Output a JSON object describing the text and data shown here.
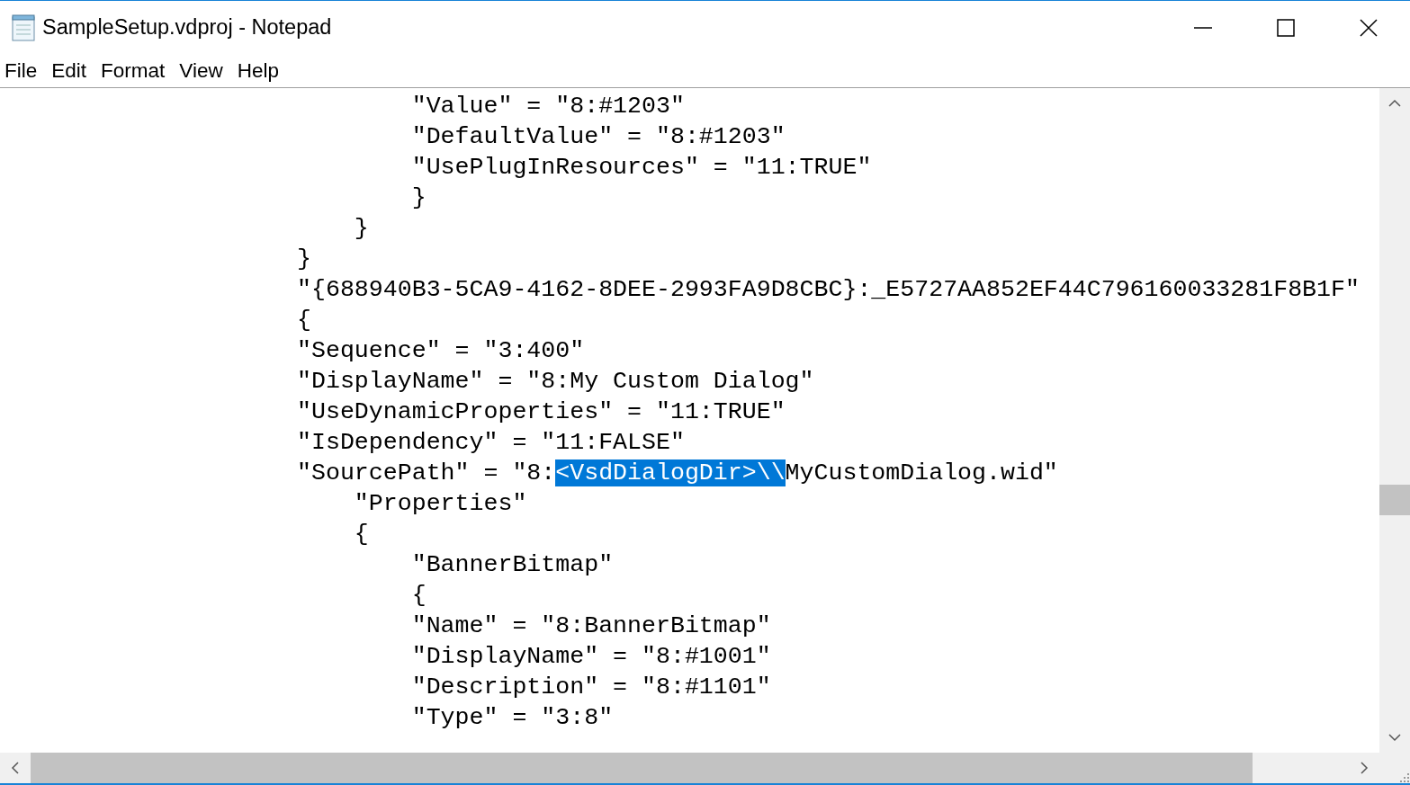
{
  "window": {
    "title": "SampleSetup.vdproj - Notepad"
  },
  "menu": [
    "File",
    "Edit",
    "Format",
    "View",
    "Help"
  ],
  "editor": {
    "lines": [
      [
        {
          "text": "        \"Value\" = \"8:#1203\"",
          "selected": false
        }
      ],
      [
        {
          "text": "        \"DefaultValue\" = \"8:#1203\"",
          "selected": false
        }
      ],
      [
        {
          "text": "        \"UsePlugInResources\" = \"11:TRUE\"",
          "selected": false
        }
      ],
      [
        {
          "text": "        }",
          "selected": false
        }
      ],
      [
        {
          "text": "    }",
          "selected": false
        }
      ],
      [
        {
          "text": "}",
          "selected": false
        }
      ],
      [
        {
          "text": "\"{688940B3-5CA9-4162-8DEE-2993FA9D8CBC}:_E5727AA852EF44C796160033281F8B1F\"",
          "selected": false
        }
      ],
      [
        {
          "text": "{",
          "selected": false
        }
      ],
      [
        {
          "text": "\"Sequence\" = \"3:400\"",
          "selected": false
        }
      ],
      [
        {
          "text": "\"DisplayName\" = \"8:My Custom Dialog\"",
          "selected": false
        }
      ],
      [
        {
          "text": "\"UseDynamicProperties\" = \"11:TRUE\"",
          "selected": false
        }
      ],
      [
        {
          "text": "\"IsDependency\" = \"11:FALSE\"",
          "selected": false
        }
      ],
      [
        {
          "text": "\"SourcePath\" = \"8:",
          "selected": false
        },
        {
          "text": "<VsdDialogDir>\\\\",
          "selected": true
        },
        {
          "text": "MyCustomDialog.wid\"",
          "selected": false
        }
      ],
      [
        {
          "text": "    \"Properties\"",
          "selected": false
        }
      ],
      [
        {
          "text": "    {",
          "selected": false
        }
      ],
      [
        {
          "text": "        \"BannerBitmap\"",
          "selected": false
        }
      ],
      [
        {
          "text": "        {",
          "selected": false
        }
      ],
      [
        {
          "text": "        \"Name\" = \"8:BannerBitmap\"",
          "selected": false
        }
      ],
      [
        {
          "text": "        \"DisplayName\" = \"8:#1001\"",
          "selected": false
        }
      ],
      [
        {
          "text": "        \"Description\" = \"8:#1101\"",
          "selected": false
        }
      ],
      [
        {
          "text": "        \"Type\" = \"3:8\"",
          "selected": false
        }
      ]
    ]
  }
}
